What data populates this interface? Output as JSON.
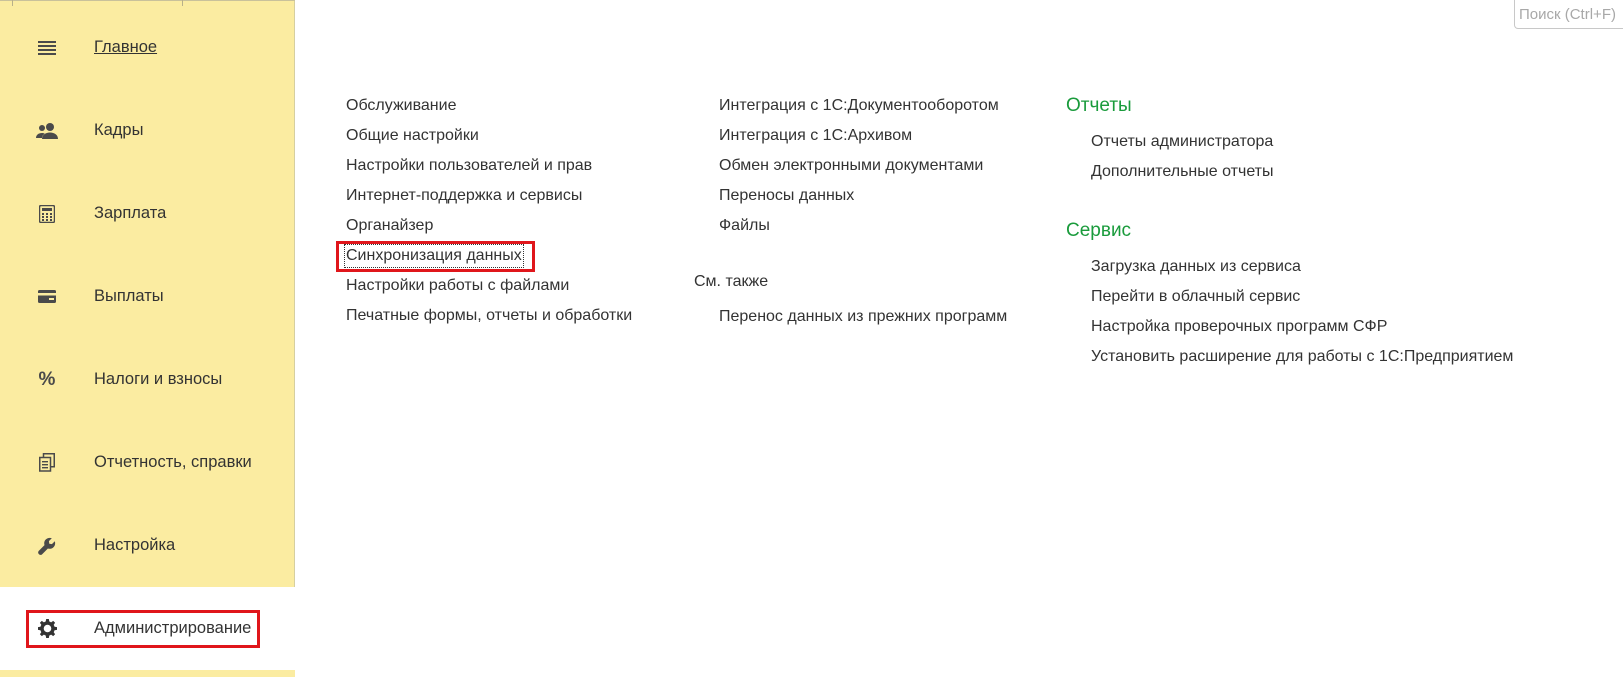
{
  "sidebar": {
    "items": [
      {
        "label": "Главное",
        "icon": "menu-lines-icon"
      },
      {
        "label": "Кадры",
        "icon": "people-icon"
      },
      {
        "label": "Зарплата",
        "icon": "calculator-icon"
      },
      {
        "label": "Выплаты",
        "icon": "card-icon"
      },
      {
        "label": "Налоги и взносы",
        "icon": "percent-icon"
      },
      {
        "label": "Отчетность, справки",
        "icon": "documents-icon"
      },
      {
        "label": "Настройка",
        "icon": "wrench-icon"
      },
      {
        "label": "Администрирование",
        "icon": "gear-icon"
      }
    ],
    "active_index": 7
  },
  "search": {
    "placeholder": "Поиск (Ctrl+F)"
  },
  "columns": {
    "col1": [
      "Обслуживание",
      "Общие настройки",
      "Настройки пользователей и прав",
      "Интернет-поддержка и сервисы",
      "Органайзер",
      "Синхронизация данных",
      "Настройки работы с файлами",
      "Печатные формы, отчеты и обработки"
    ],
    "col2": [
      "Интеграция с 1С:Документооборотом",
      "Интеграция с 1С:Архивом",
      "Обмен электронными документами",
      "Переносы данных",
      "Файлы"
    ],
    "see_also_title": "См. также",
    "see_also": [
      "Перенос данных из прежних программ"
    ],
    "reports_title": "Отчеты",
    "reports": [
      "Отчеты администратора",
      "Дополнительные отчеты"
    ],
    "service_title": "Сервис",
    "service": [
      "Загрузка данных из сервиса",
      "Перейти в облачный сервис",
      "Настройка проверочных программ СФР",
      "Установить расширение для работы с 1С:Предприятием"
    ]
  },
  "colors": {
    "sidebar_bg": "#fbeca1",
    "section_title": "#1a9b3c",
    "highlight": "#e0161b"
  }
}
